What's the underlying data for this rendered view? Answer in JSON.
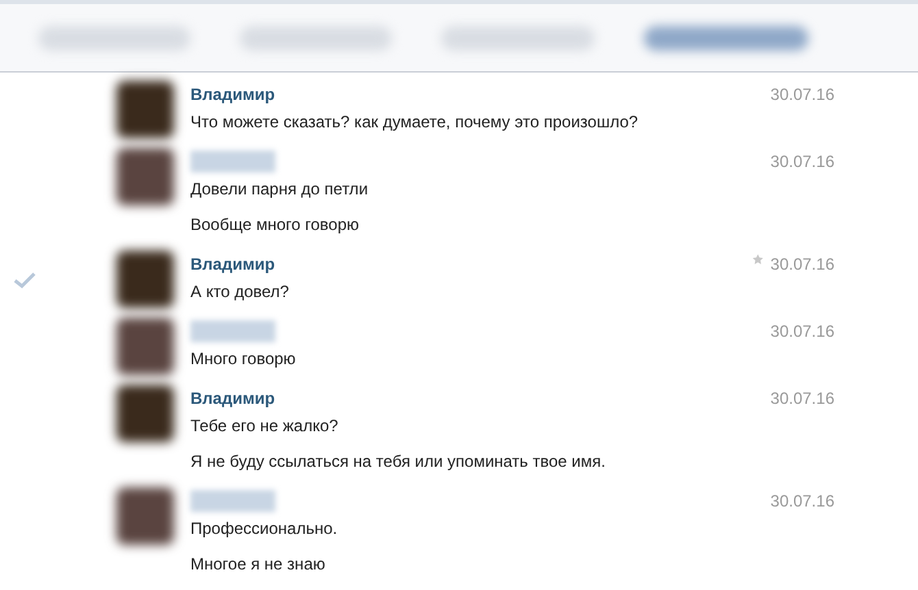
{
  "tabs": [
    {
      "selected": false
    },
    {
      "selected": false
    },
    {
      "selected": false
    },
    {
      "selected": true
    }
  ],
  "messages": [
    {
      "sender": "Владимир",
      "date": "30.07.16",
      "selected": false,
      "starred": false,
      "texts": [
        "Что можете сказать? как думаете, почему это произошло?"
      ]
    },
    {
      "date": "30.07.16",
      "selected": false,
      "starred": false,
      "texts": [
        "Довели парня до петли",
        "Вообще много говорю"
      ]
    },
    {
      "sender": "Владимир",
      "date": "30.07.16",
      "selected": true,
      "starred": true,
      "texts": [
        "А кто довел?"
      ]
    },
    {
      "date": "30.07.16",
      "selected": false,
      "starred": false,
      "texts": [
        "Много говорю"
      ]
    },
    {
      "sender": "Владимир",
      "date": "30.07.16",
      "selected": false,
      "starred": false,
      "texts": [
        "Тебе его не жалко?",
        "Я не буду ссылаться на тебя или упоминать твое имя."
      ]
    },
    {
      "date": "30.07.16",
      "selected": false,
      "starred": false,
      "texts": [
        "Профессионально.",
        "Многое я не знаю"
      ]
    }
  ]
}
